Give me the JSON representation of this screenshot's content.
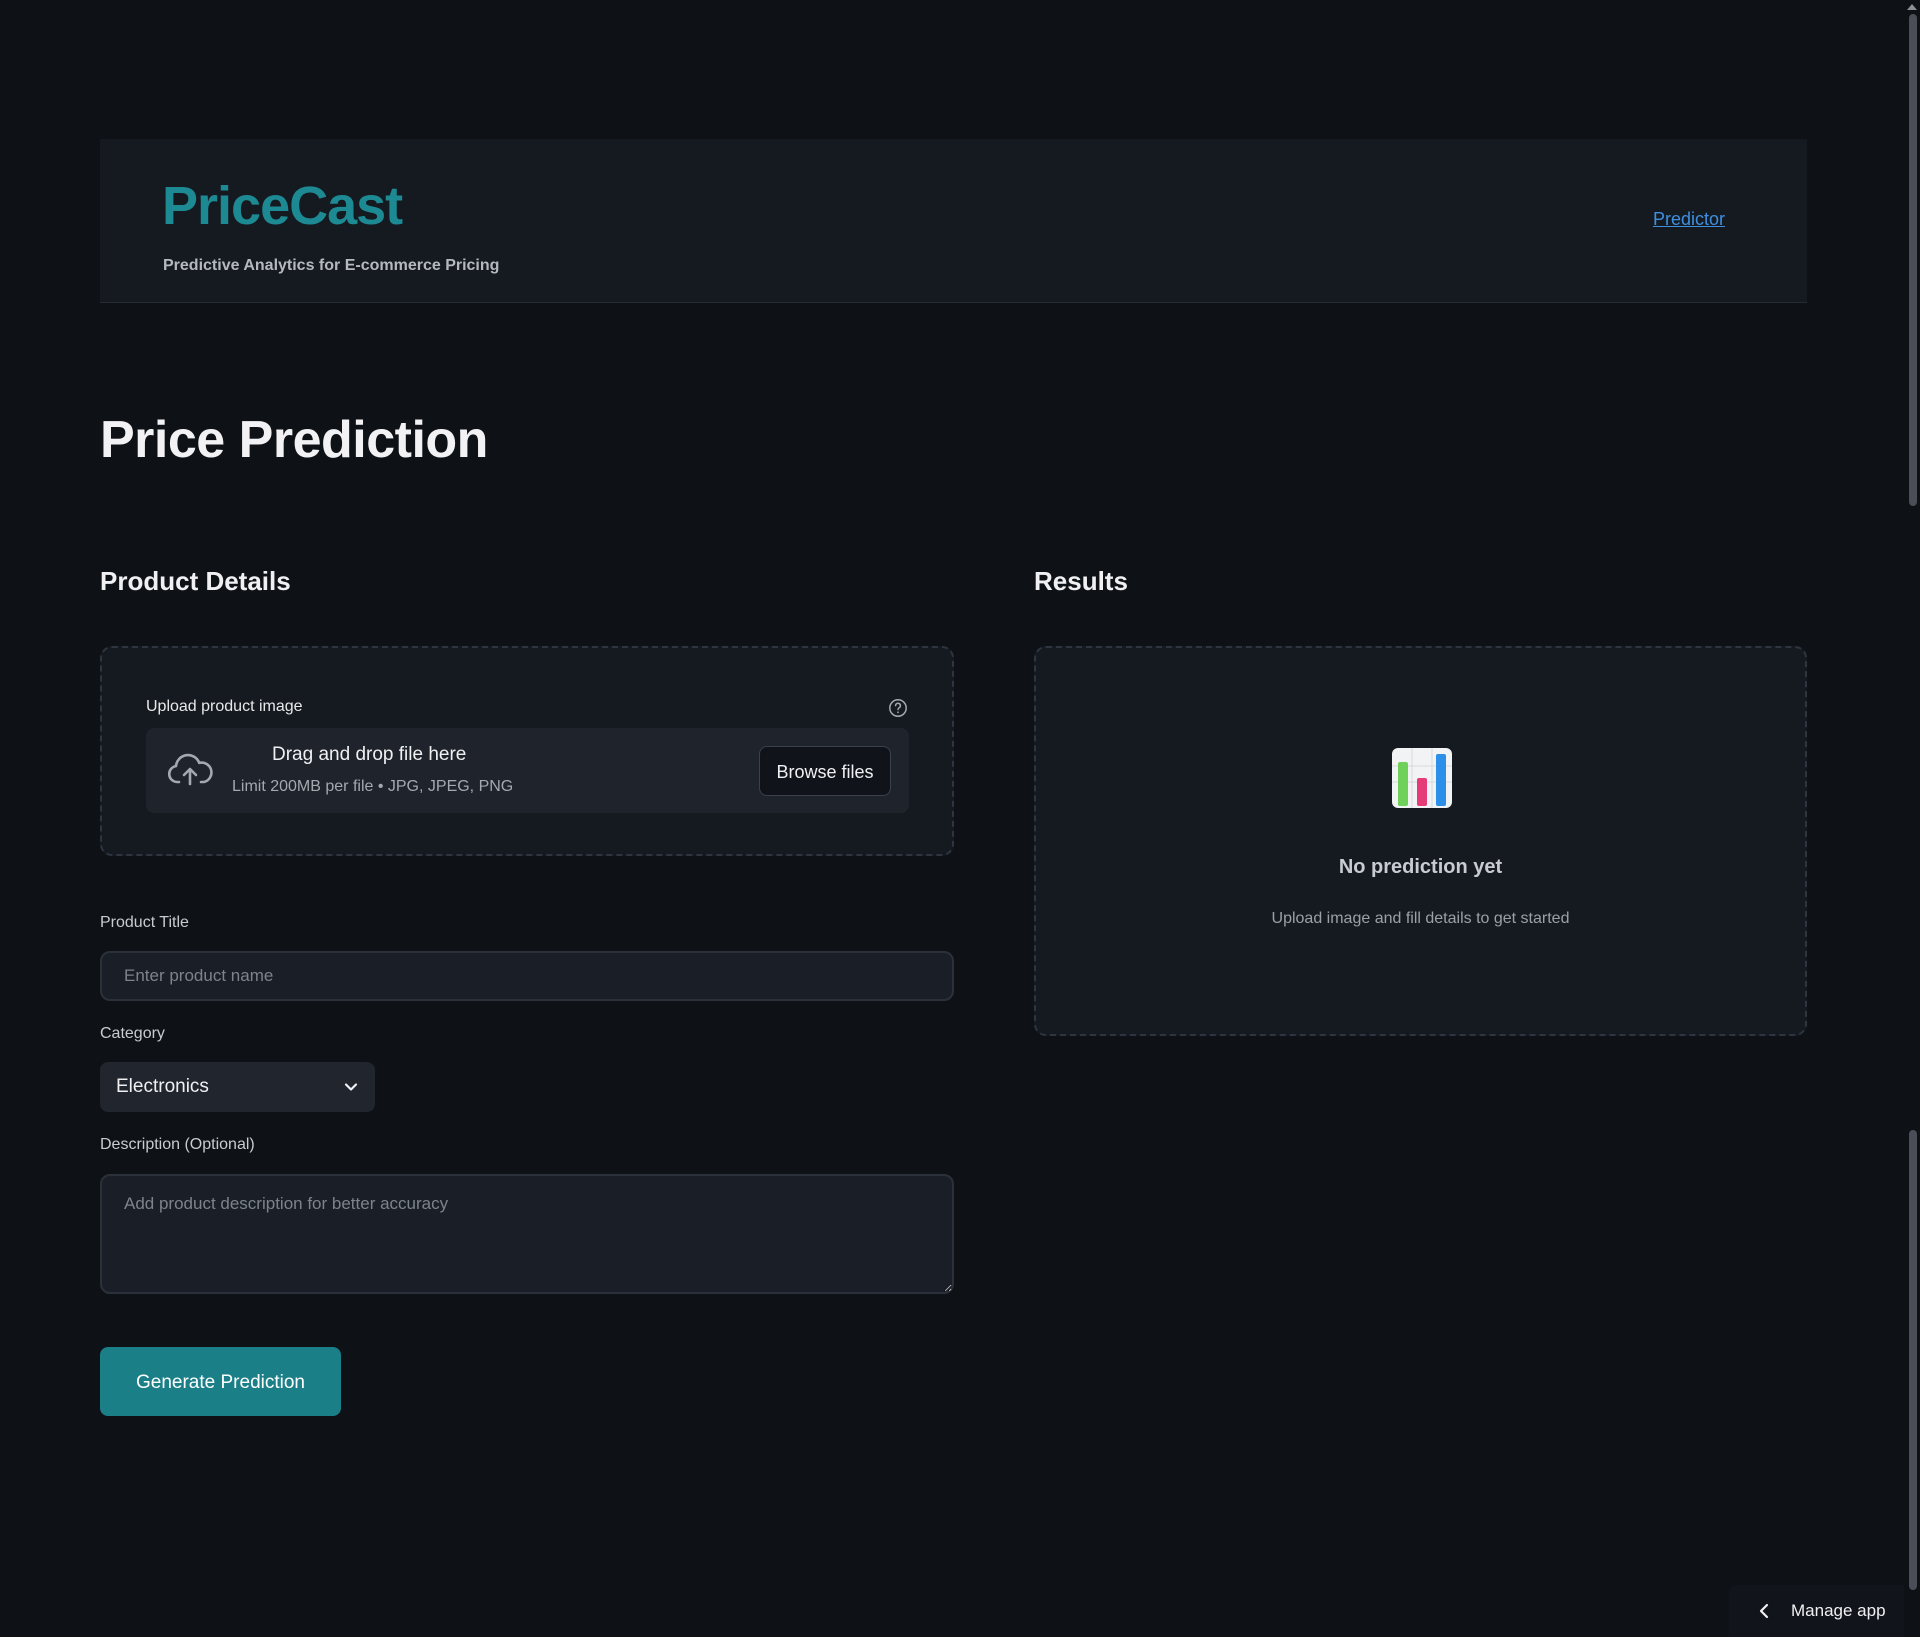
{
  "header": {
    "brand": "PriceCast",
    "tagline": "Predictive Analytics for E-commerce Pricing",
    "nav_link": "Predictor"
  },
  "page_title": "Price Prediction",
  "product_details": {
    "title": "Product Details",
    "upload": {
      "label": "Upload product image",
      "drop_title": "Drag and drop file here",
      "limit": "Limit 200MB per file • JPG, JPEG, PNG",
      "browse_label": "Browse files"
    },
    "product_title": {
      "label": "Product Title",
      "placeholder": "Enter product name",
      "value": ""
    },
    "category": {
      "label": "Category",
      "selected": "Electronics"
    },
    "description": {
      "label": "Description (Optional)",
      "placeholder": "Add product description for better accuracy",
      "value": ""
    },
    "submit_label": "Generate Prediction"
  },
  "results": {
    "title": "Results",
    "empty_title": "No prediction yet",
    "empty_subtitle": "Upload image and fill details to get started"
  },
  "footer": {
    "manage_app": "Manage app"
  },
  "colors": {
    "background": "#0e1217",
    "panel": "#151a21",
    "brand": "#1d8a93",
    "primary_button": "#1b7f88",
    "link": "#3f8fe0"
  },
  "icons": {
    "help": "question-circle-icon",
    "upload": "cloud-upload-icon",
    "dropdown": "chevron-down-icon",
    "results": "bar-chart-icon",
    "manage": "chevron-left-icon"
  }
}
